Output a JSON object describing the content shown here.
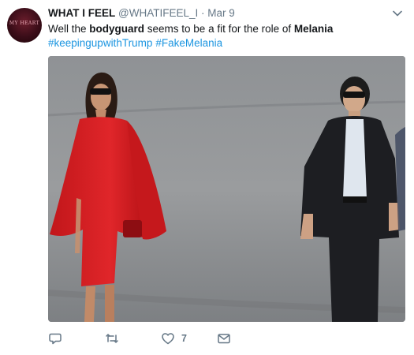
{
  "tweet": {
    "display_name": "WHAT I FEEL",
    "handle": "@WHATIFEEL_I",
    "separator": "·",
    "date": "Mar 9",
    "avatar_text": "MY HEART",
    "text_parts": [
      "Well the ",
      "bodyguard",
      " seems to be a fit for the role of ",
      "Melania"
    ],
    "hashtags": [
      "#keepingupwithTrump",
      "#FakeMelania"
    ],
    "media": {
      "description_icon": "photo-image"
    },
    "actions": {
      "reply_icon": "reply-icon",
      "retweet_icon": "retweet-icon",
      "like_icon": "heart-icon",
      "like_count": "7",
      "dm_icon": "envelope-icon"
    }
  },
  "colors": {
    "text": "#14171a",
    "muted": "#657786",
    "link": "#1b95e0"
  }
}
